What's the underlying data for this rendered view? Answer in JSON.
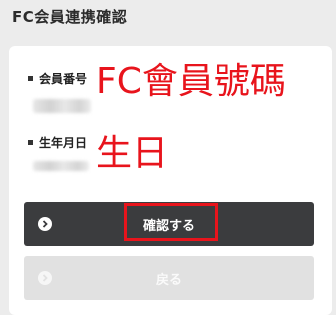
{
  "header": {
    "title": "FC会員連携確認"
  },
  "form": {
    "member_number_label": "会員番号",
    "birthdate_label": "生年月日"
  },
  "annotations": {
    "member_number_note": "FC會員號碼",
    "birthdate_note": "生日",
    "color": "#e8141c"
  },
  "buttons": {
    "confirm_label": "確認する",
    "back_label": "戻る"
  },
  "icons": {
    "confirm": "chevron-right-circle-icon",
    "back": "chevron-right-circle-icon"
  },
  "colors": {
    "page_bg": "#ececec",
    "card_bg": "#ffffff",
    "confirm_button_bg": "#3b3c3e",
    "back_button_bg": "#e1e1e1",
    "highlight": "#e8141c"
  }
}
